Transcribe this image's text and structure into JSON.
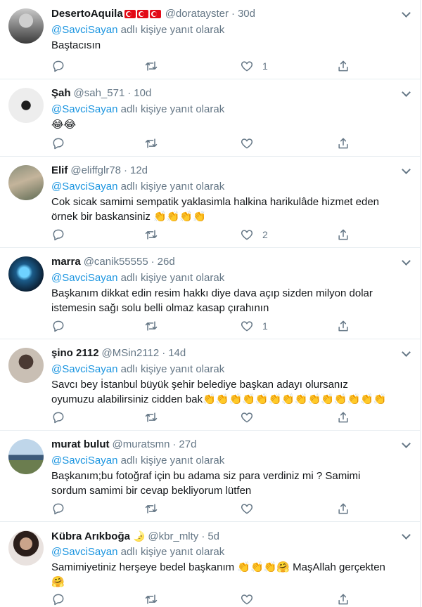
{
  "reply_prefix_suffix": " adlı kişiye yanıt olarak",
  "tweets": [
    {
      "name": "DesertoAquila",
      "flags": "🇹🇷🇹🇷🇹🇷",
      "handle": "@doratayster",
      "time": "30d",
      "mention": "@SavciSayan",
      "text": "Baştacısın",
      "likes": "1"
    },
    {
      "name": "Şah",
      "handle": "@sah_571",
      "time": "10d",
      "mention": "@SavciSayan",
      "text": "😂😂",
      "likes": ""
    },
    {
      "name": "Elif",
      "handle": "@eliffglr78",
      "time": "12d",
      "mention": "@SavciSayan",
      "text": "Cok sicak samimi sempatik yaklasimla halkina harikulâde hizmet eden örnek bir baskansiniz 👏👏👏👏",
      "likes": "2"
    },
    {
      "name": "marra",
      "handle": "@canik55555",
      "time": "26d",
      "mention": "@SavciSayan",
      "text": "Başkanım dikkat edin resim hakkı diye dava açıp sizden milyon dolar istemesin sağı solu belli olmaz kasap çırahının",
      "likes": "1"
    },
    {
      "name": "şino 2112",
      "handle": "@MSin2112",
      "time": "14d",
      "mention": "@SavciSayan",
      "text": "Savcı bey İstanbul büyük şehir belediye başkan adayı olursanız oyumuzu alabilirsiniz cidden bak👏👏👏👏👏👏👏👏👏👏👏👏👏👏",
      "likes": ""
    },
    {
      "name": "murat bulut",
      "handle": "@muratsmn",
      "time": "27d",
      "mention": "@SavciSayan",
      "text": "Başkanım;bu fotoğraf için bu adama siz para verdiniz mi ? Samimi sordum samimi bir cevap bekliyorum lütfen",
      "likes": ""
    },
    {
      "name": "Kübra Arıkboğa",
      "badge": "🌛",
      "handle": "@kbr_mlty",
      "time": "5d",
      "mention": "@SavciSayan",
      "text": "Samimiyetiniz herşeye bedel başkanım 👏👏👏🤗 MaşAllah gerçekten 🤗",
      "likes": ""
    }
  ],
  "icons": [
    "reply-icon",
    "retweet-icon",
    "like-icon",
    "share-icon",
    "caret-down-icon"
  ],
  "colors": {
    "link": "#1b95e0",
    "secondary_text": "#657786",
    "divider": "#e6ecf0",
    "flag_red": "#e30a17"
  }
}
